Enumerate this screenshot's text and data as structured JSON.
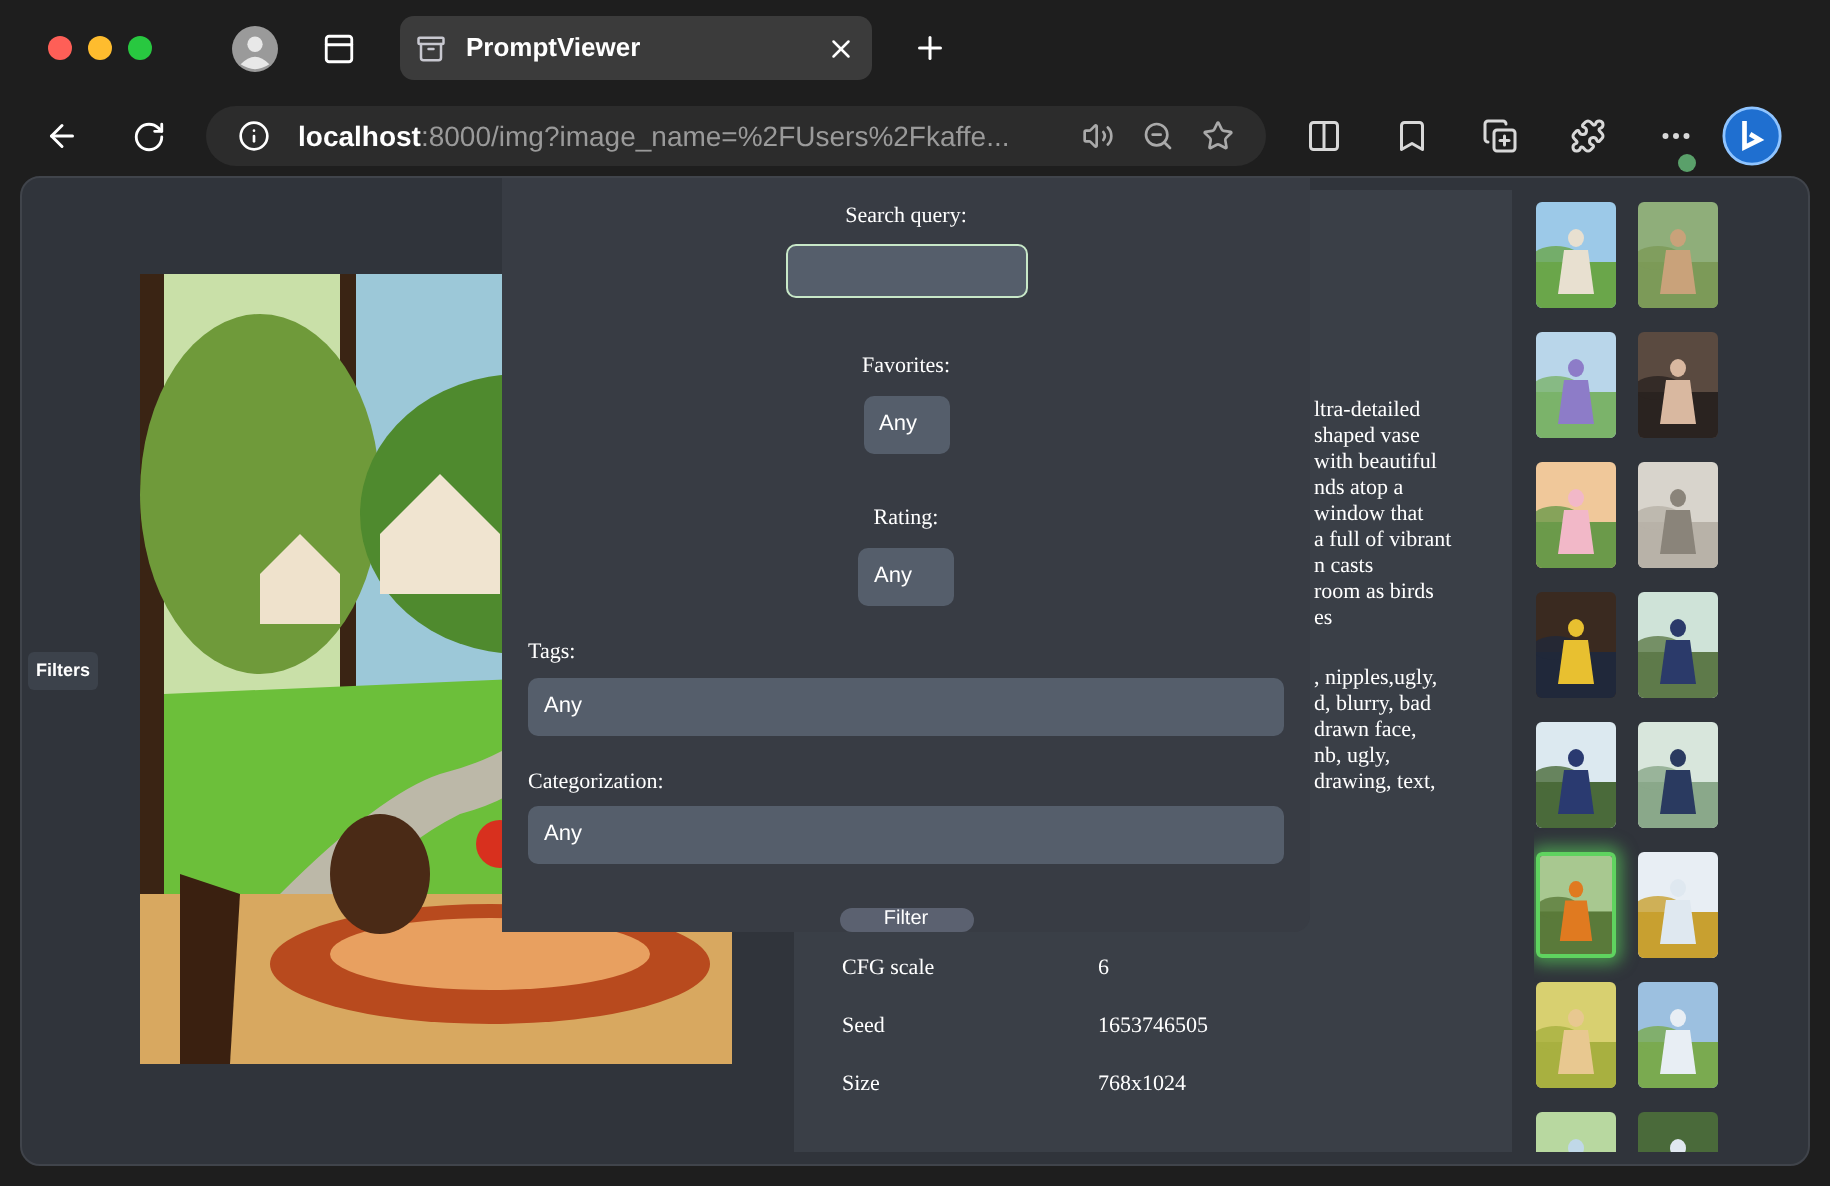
{
  "browser": {
    "tab": {
      "title": "PromptViewer",
      "selected": true
    },
    "url": {
      "host": "localhost",
      "rest": ":8000/img?image_name=%2FUsers%2Fkaffe..."
    }
  },
  "filters_button": "Filters",
  "details": {
    "prompt_lines": [
      "ltra-detailed",
      "shaped vase",
      "with beautiful",
      "nds atop a",
      "window that",
      "a full of vibrant",
      "n casts",
      "room as birds",
      "es"
    ],
    "negative_lines": [
      ", nipples,ugly,",
      "d, blurry, bad",
      "drawn face,",
      "nb, ugly,",
      "drawing, text,"
    ],
    "rows": [
      {
        "label": "CFG scale",
        "value": "6"
      },
      {
        "label": "Seed",
        "value": "1653746505"
      },
      {
        "label": "Size",
        "value": "768x1024"
      }
    ]
  },
  "thumbnails": [
    {
      "selected": false
    },
    {
      "selected": false
    },
    {
      "selected": false
    },
    {
      "selected": false
    },
    {
      "selected": false
    },
    {
      "selected": false
    },
    {
      "selected": false
    },
    {
      "selected": false
    },
    {
      "selected": false
    },
    {
      "selected": false
    },
    {
      "selected": true
    },
    {
      "selected": false
    },
    {
      "selected": false
    },
    {
      "selected": false
    },
    {
      "selected": false
    },
    {
      "selected": false
    }
  ],
  "filter_panel": {
    "search": {
      "label": "Search query:"
    },
    "favorites": {
      "label": "Favorites:",
      "value": "Any"
    },
    "rating": {
      "label": "Rating:",
      "value": "Any"
    },
    "tags": {
      "label": "Tags:",
      "value": "Any"
    },
    "categorization": {
      "label": "Categorization:",
      "value": "Any"
    },
    "button": "Filter"
  }
}
